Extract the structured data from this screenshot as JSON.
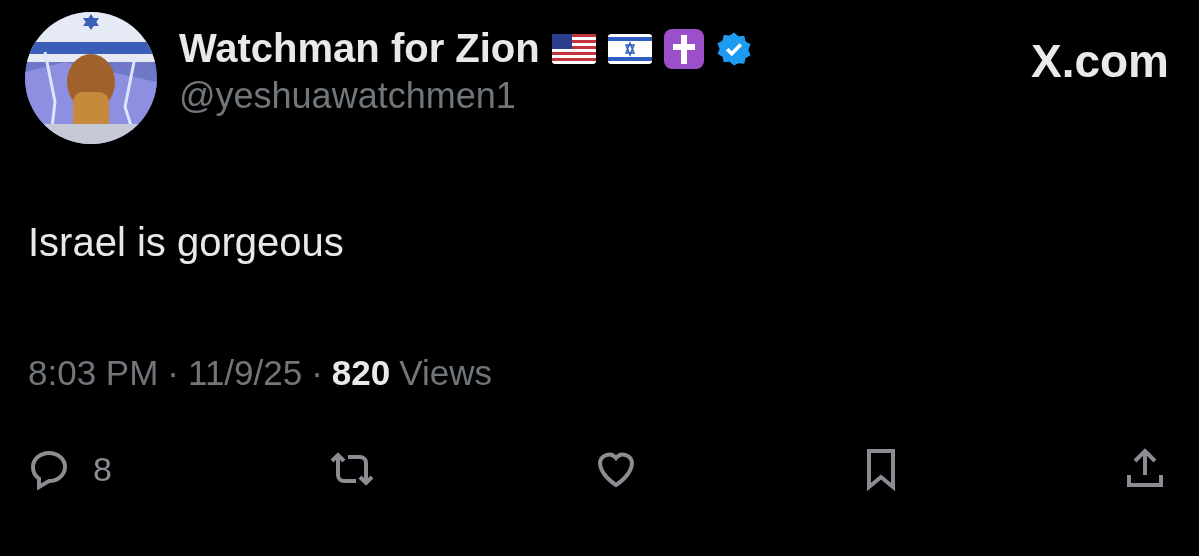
{
  "author": {
    "name": "Watchman for Zion",
    "handle": "@yeshuawatchmen1",
    "verified": true,
    "badges": [
      {
        "kind": "us_flag"
      },
      {
        "kind": "israel_flag"
      },
      {
        "kind": "cross"
      }
    ]
  },
  "site_label": "X.com",
  "text": "Israel is gorgeous",
  "meta": {
    "time": "8:03 PM",
    "separator": "·",
    "date": "11/9/25",
    "views_count": "820",
    "views_label": "Views"
  },
  "actions": [
    {
      "kind": "reply",
      "count": "8"
    },
    {
      "kind": "repost"
    },
    {
      "kind": "like"
    },
    {
      "kind": "bookmark"
    },
    {
      "kind": "share"
    }
  ]
}
